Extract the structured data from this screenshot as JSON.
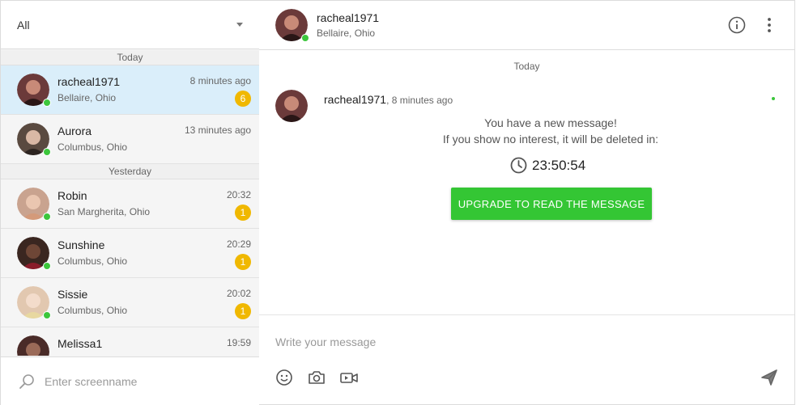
{
  "filter": {
    "selected": "All"
  },
  "conversations": {
    "dividers": [
      "Today",
      "Yesterday"
    ],
    "items": [
      {
        "name": "racheal1971",
        "location": "Bellaire, Ohio",
        "time": "8 minutes ago",
        "badge": "6",
        "avatar_color": "#6b3a3a"
      },
      {
        "name": "Aurora",
        "location": "Columbus, Ohio",
        "time": "13 minutes ago",
        "badge": "",
        "avatar_color": "#5a4a40"
      },
      {
        "name": "Robin",
        "location": "San Margherita, Ohio",
        "time": "20:32",
        "badge": "1",
        "avatar_color": "#c9a38f"
      },
      {
        "name": "Sunshine",
        "location": "Columbus, Ohio",
        "time": "20:29",
        "badge": "1",
        "avatar_color": "#3a2620"
      },
      {
        "name": "Sissie",
        "location": "Columbus, Ohio",
        "time": "20:02",
        "badge": "1",
        "avatar_color": "#e2c8b0"
      },
      {
        "name": "Melissa1",
        "location": "",
        "time": "19:59",
        "badge": "",
        "avatar_color": "#4a2b28"
      }
    ]
  },
  "search": {
    "placeholder": "Enter screenname"
  },
  "header": {
    "name": "racheal1971",
    "location": "Bellaire, Ohio"
  },
  "chat": {
    "day": "Today",
    "message": {
      "sender": "racheal1971",
      "time": ", 8 minutes ago",
      "line1": "You have a new message!",
      "line2": "If you show no interest, it will be deleted in:",
      "countdown": "23:50:54",
      "button": "UPGRADE TO READ THE MESSAGE"
    }
  },
  "composer": {
    "placeholder": "Write your message"
  },
  "colors": {
    "accent_green": "#34c634",
    "online": "#3cc63c",
    "badge": "#f0b800",
    "active_row": "#daeefa"
  },
  "icons": [
    "search-icon",
    "info-icon",
    "more-vertical-icon",
    "clock-icon",
    "emoji-icon",
    "camera-icon",
    "video-icon",
    "send-icon"
  ]
}
